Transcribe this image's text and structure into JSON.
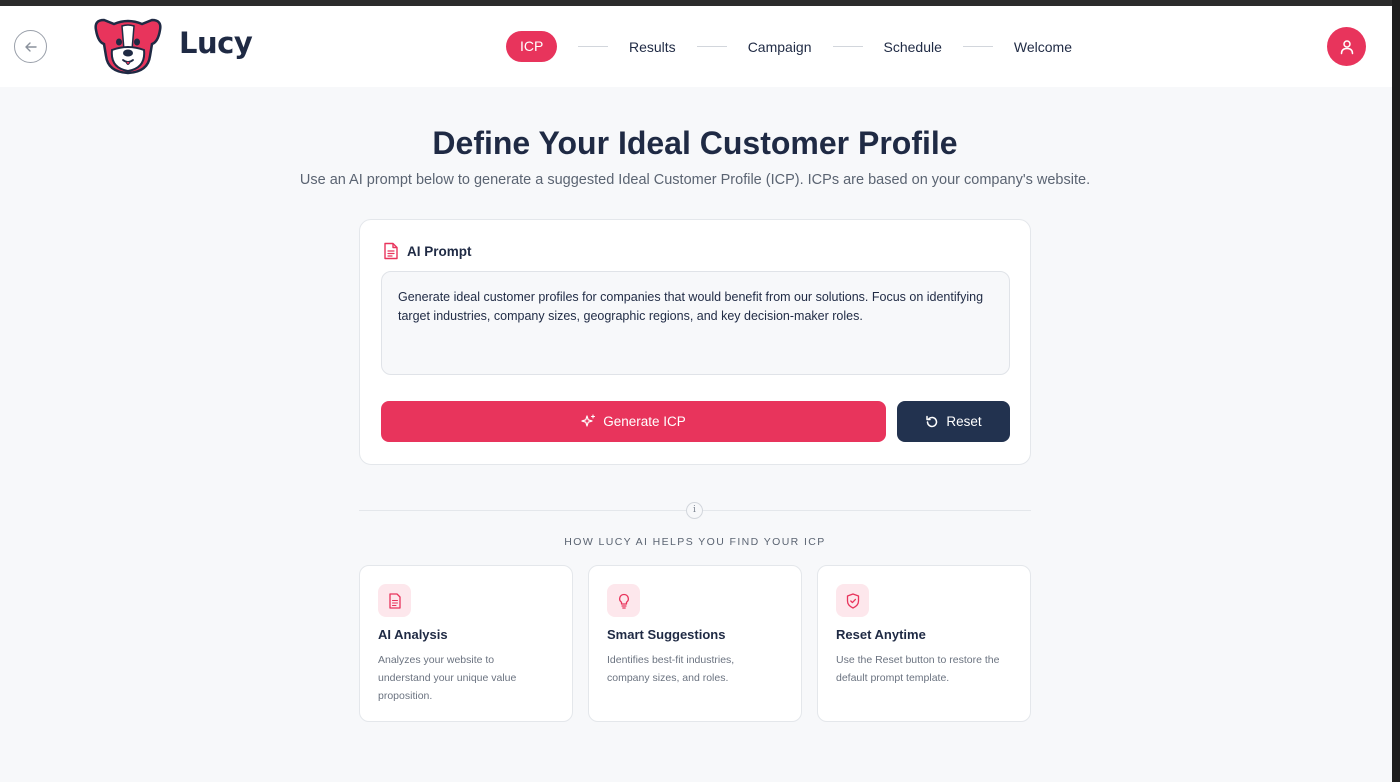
{
  "app": {
    "brand": "Lucy"
  },
  "steps": [
    {
      "label": "ICP",
      "active": true
    },
    {
      "label": "Results"
    },
    {
      "label": "Campaign"
    },
    {
      "label": "Schedule"
    },
    {
      "label": "Welcome"
    }
  ],
  "page": {
    "title": "Define Your Ideal Customer Profile",
    "subtitle": "Use an AI prompt below to generate a suggested Ideal Customer Profile (ICP). ICPs are based on your company's website."
  },
  "prompt": {
    "label": "AI Prompt",
    "value": "Generate ideal customer profiles for companies that would benefit from our solutions. Focus on identifying target industries, company sizes, geographic regions, and key decision-maker roles."
  },
  "buttons": {
    "generate": "Generate ICP",
    "reset": "Reset"
  },
  "info_icon": "i",
  "how": {
    "label": "HOW LUCY AI HELPS YOU FIND YOUR ICP",
    "features": [
      {
        "icon": "document-icon",
        "title": "AI Analysis",
        "desc": "Analyzes your website to understand your unique value proposition."
      },
      {
        "icon": "lightbulb-icon",
        "title": "Smart Suggestions",
        "desc": "Identifies best-fit industries, company sizes, and roles."
      },
      {
        "icon": "shield-icon",
        "title": "Reset Anytime",
        "desc": "Use the Reset button to restore the default prompt template."
      }
    ]
  },
  "colors": {
    "accent": "#e8345c",
    "navy": "#22324f",
    "background": "#f7f8fa"
  }
}
